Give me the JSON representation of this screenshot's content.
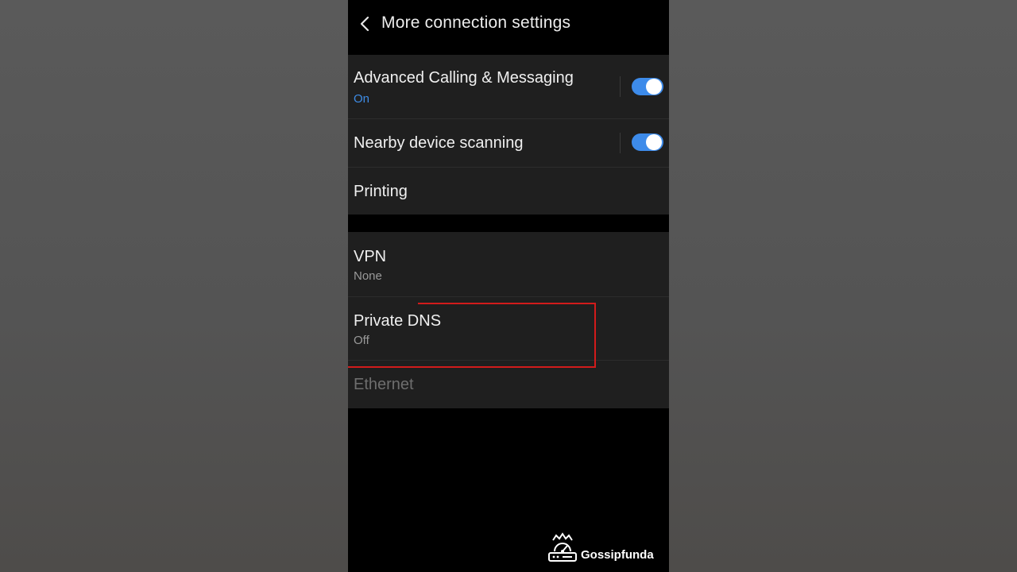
{
  "header": {
    "title": "More connection settings",
    "back_icon": "chevron-left-icon"
  },
  "settings": [
    {
      "title": "Advanced Calling & Messaging",
      "subtitle": "On",
      "toggle": true
    },
    {
      "title": "Nearby device scanning",
      "toggle": true
    },
    {
      "title": "Printing"
    }
  ],
  "network": [
    {
      "title": "VPN",
      "subtitle": "None"
    },
    {
      "title": "Private DNS",
      "subtitle": "Off",
      "highlighted": true
    },
    {
      "title": "Ethernet",
      "disabled": true
    }
  ],
  "watermark": {
    "text": "Gossipfunda",
    "icon": "router-logo-icon"
  },
  "colors": {
    "accent": "#3d8bea",
    "on_text": "#3e8ce6",
    "highlight": "#d21b1b",
    "card_bg": "#1f1f1f"
  }
}
